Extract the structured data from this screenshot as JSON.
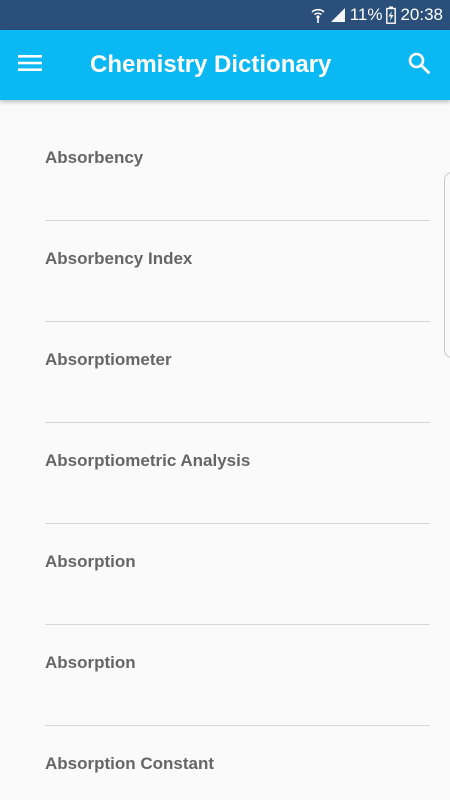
{
  "status_bar": {
    "battery": "11%",
    "time": "20:38",
    "icons": [
      "wifi-icon",
      "signal-icon",
      "battery-charging-icon"
    ]
  },
  "app_bar": {
    "title": "Chemistry Dictionary",
    "menu_icon": "hamburger-menu-icon",
    "search_icon": "search-icon"
  },
  "terms": [
    "Absorbency",
    "Absorbency Index",
    "Absorptiometer",
    "Absorptiometric Analysis",
    "Absorption",
    "Absorption",
    "Absorption Constant"
  ],
  "colors": {
    "status_bar": "#2a4f7a",
    "app_bar": "#0ab8f3",
    "background": "#fafafa",
    "item_text": "#666666",
    "divider": "#d6d6d6"
  }
}
